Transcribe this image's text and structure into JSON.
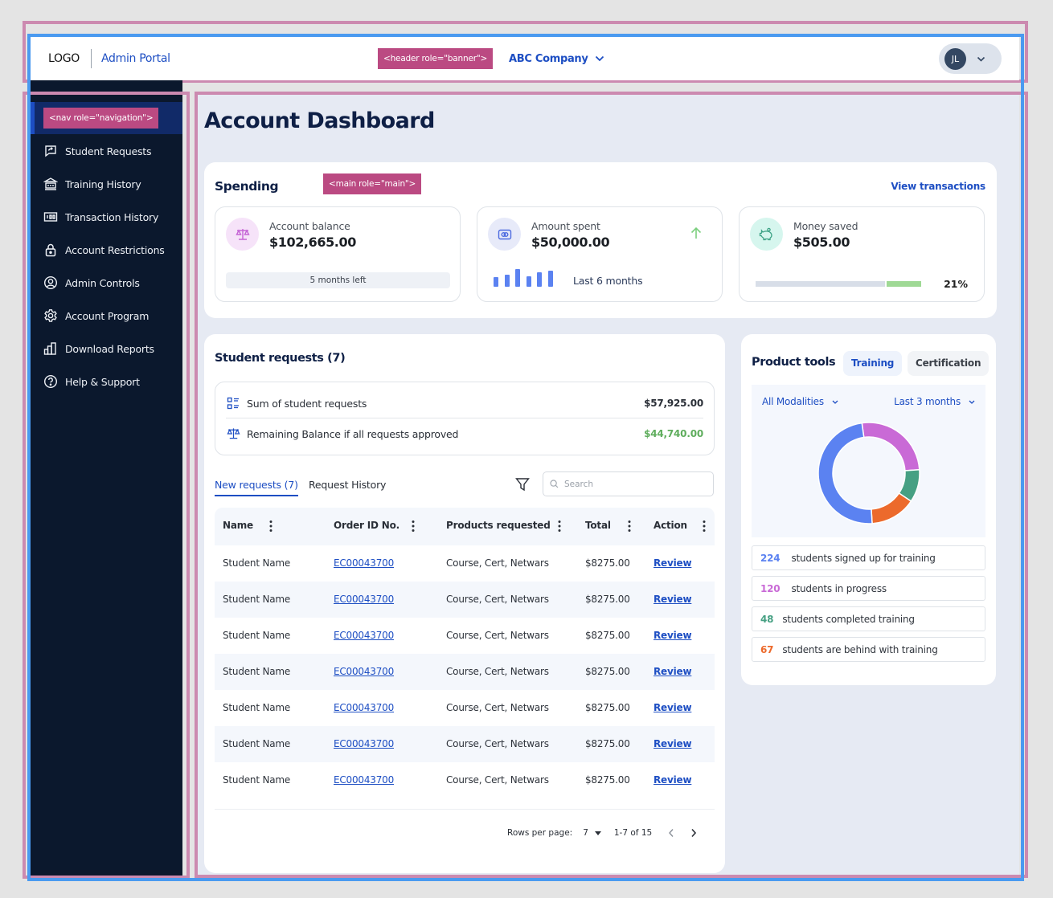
{
  "header": {
    "logo": "LOGO",
    "portal_name": "Admin Portal",
    "company": "ABC Company",
    "user_initials": "JL",
    "role_tag": "<header role=\"banner\">"
  },
  "sidebar": {
    "role_tag": "<nav role=\"navigation\">",
    "items": [
      {
        "label": "Student Requests",
        "icon": "message-share-icon"
      },
      {
        "label": "Training History",
        "icon": "bank-icon"
      },
      {
        "label": "Transaction History",
        "icon": "counter-icon"
      },
      {
        "label": "Account Restrictions",
        "icon": "lock-icon"
      },
      {
        "label": "Admin Controls",
        "icon": "user-circle-icon"
      },
      {
        "label": "Account Program",
        "icon": "gear-icon"
      },
      {
        "label": "Download Reports",
        "icon": "bar-chart-icon"
      },
      {
        "label": "Help & Support",
        "icon": "help-circle-icon"
      }
    ]
  },
  "main": {
    "role_tag": "<main role=\"main\">",
    "page_title": "Account Dashboard",
    "spending": {
      "title": "Spending",
      "view_link": "View transactions",
      "account_balance": {
        "label": "Account balance",
        "value": "$102,665.00",
        "note": "5 months left"
      },
      "amount_spent": {
        "label": "Amount spent",
        "value": "$50,000.00",
        "period": "Last 6 months",
        "trend": "up",
        "bars_relative": [
          0.55,
          0.7,
          1.0,
          0.6,
          0.8,
          0.9
        ]
      },
      "money_saved": {
        "label": "Money saved",
        "value": "$505.00",
        "percent_label": "21%",
        "progress": 0.21
      }
    },
    "requests": {
      "title": "Student requests (7)",
      "sum_label": "Sum of student requests",
      "sum_value": "$57,925.00",
      "remaining_label": "Remaining Balance if all requests approved",
      "remaining_value": "$44,740.00",
      "tabs": [
        "New requests (7)",
        "Request History"
      ],
      "search_placeholder": "Search",
      "columns": [
        "Name",
        "Order ID No.",
        "Products requested",
        "Total",
        "Action"
      ],
      "rows": [
        {
          "name": "Student Name",
          "order_id": "EC00043700",
          "products": "Course, Cert, Netwars",
          "total": "$8275.00",
          "action": "Review"
        },
        {
          "name": "Student Name",
          "order_id": "EC00043700",
          "products": "Course, Cert, Netwars",
          "total": "$8275.00",
          "action": "Review"
        },
        {
          "name": "Student Name",
          "order_id": "EC00043700",
          "products": "Course, Cert, Netwars",
          "total": "$8275.00",
          "action": "Review"
        },
        {
          "name": "Student Name",
          "order_id": "EC00043700",
          "products": "Course, Cert, Netwars",
          "total": "$8275.00",
          "action": "Review"
        },
        {
          "name": "Student Name",
          "order_id": "EC00043700",
          "products": "Course, Cert, Netwars",
          "total": "$8275.00",
          "action": "Review"
        },
        {
          "name": "Student Name",
          "order_id": "EC00043700",
          "products": "Course, Cert, Netwars",
          "total": "$8275.00",
          "action": "Review"
        },
        {
          "name": "Student Name",
          "order_id": "EC00043700",
          "products": "Course, Cert, Netwars",
          "total": "$8275.00",
          "action": "Review"
        }
      ],
      "pagination": {
        "rows_per_page_label": "Rows per page:",
        "rows_per_page": "7",
        "range": "1-7 of 15"
      }
    },
    "tools": {
      "title": "Product tools",
      "tabs": [
        "Training",
        "Certification"
      ],
      "modality_filter": "All Modalities",
      "period_filter": "Last 3 months",
      "stats": [
        {
          "value": "224",
          "label": "students signed up for training",
          "color": "#5b82f1"
        },
        {
          "value": "120",
          "label": "students in progress",
          "color": "#c96ad6"
        },
        {
          "value": "48",
          "label": "students completed training",
          "color": "#46a083"
        },
        {
          "value": "67",
          "label": "students are behind with training",
          "color": "#ec6a2c"
        }
      ]
    }
  },
  "chart_data": {
    "type": "pie",
    "variant": "donut",
    "title": "Product tools — Training",
    "categories": [
      "students in progress",
      "students completed training",
      "students are behind with training",
      "students signed up for training"
    ],
    "values": [
      120,
      48,
      67,
      224
    ],
    "colors": [
      "#c96ad6",
      "#46a083",
      "#ec6a2c",
      "#5b82f1"
    ],
    "legend": "below"
  }
}
